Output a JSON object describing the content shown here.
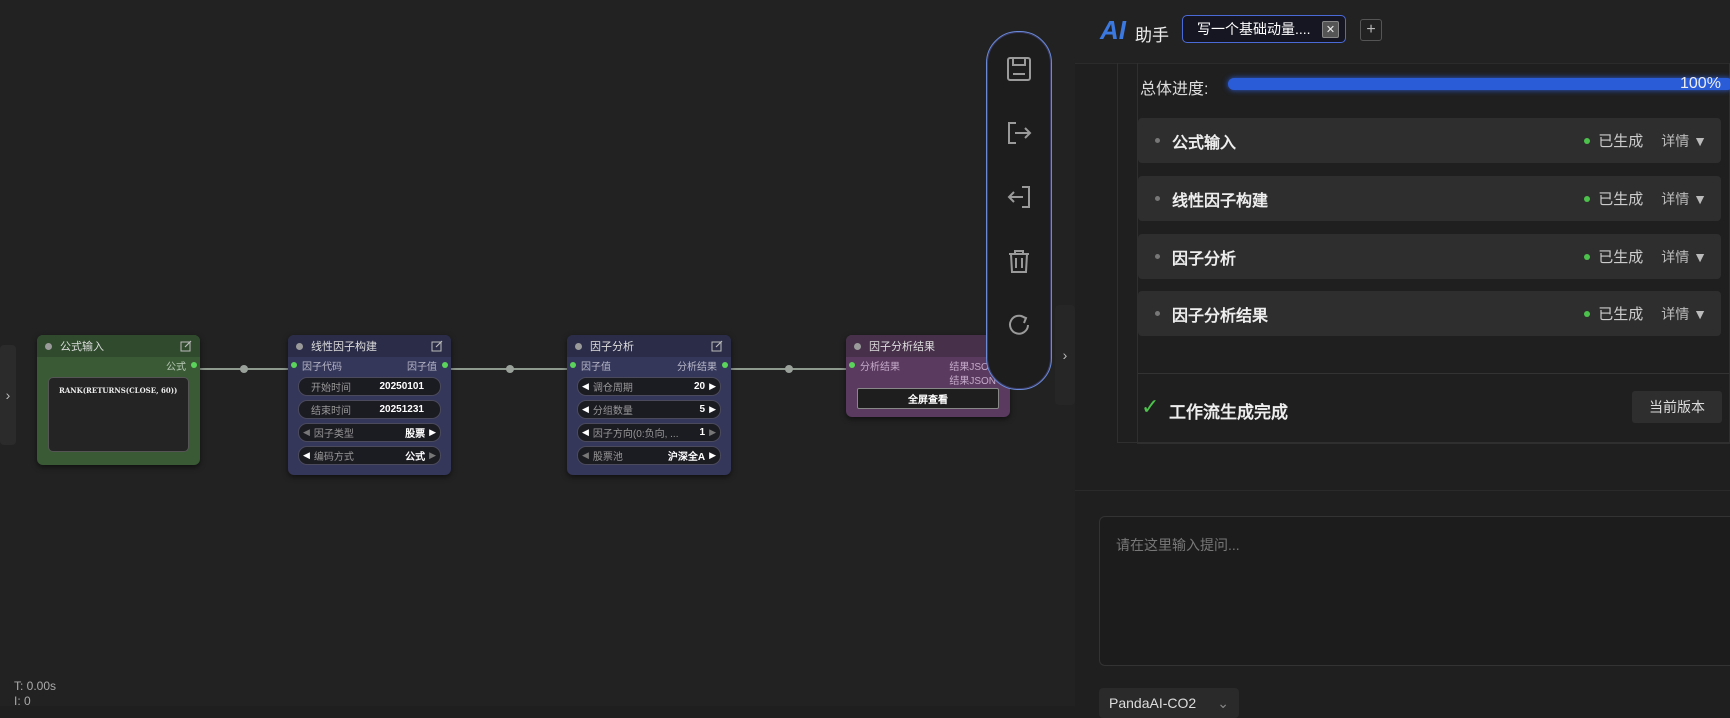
{
  "canvas": {
    "nodes": {
      "formula": {
        "title": "公式输入",
        "output_label": "公式",
        "formula_text": "RANK(RETURNS(CLOSE, 60))"
      },
      "linear": {
        "title": "线性因子构建",
        "input_label": "因子代码",
        "output_label": "因子值",
        "widgets": [
          {
            "label": "开始时间",
            "value": "20250101"
          },
          {
            "label": "结束时间",
            "value": "20251231"
          },
          {
            "label": "因子类型",
            "value": "股票"
          },
          {
            "label": "编码方式",
            "value": "公式"
          }
        ]
      },
      "analysis": {
        "title": "因子分析",
        "input_label": "因子值",
        "output_label": "分析结果",
        "widgets": [
          {
            "label": "调仓周期",
            "value": "20"
          },
          {
            "label": "分组数量",
            "value": "5"
          },
          {
            "label": "因子方向(0:负向, ...",
            "value": "1"
          },
          {
            "label": "股票池",
            "value": "沪深全A"
          }
        ]
      },
      "result": {
        "title": "因子分析结果",
        "input_label": "分析结果",
        "output_labels": [
          "结果JSON",
          "结果JSON"
        ],
        "button_label": "全屏查看"
      }
    },
    "stats": {
      "time": "T: 0.00s",
      "line2": "I: 0"
    }
  },
  "toolbar": {
    "buttons": [
      {
        "icon": "save-icon"
      },
      {
        "icon": "export-icon"
      },
      {
        "icon": "import-icon"
      },
      {
        "icon": "trash-icon"
      },
      {
        "icon": "refresh-icon"
      }
    ]
  },
  "panel": {
    "logo": "AI",
    "title": "助手",
    "tab_label": "写一个基础动量....",
    "add_tab": "+",
    "progress": {
      "label": "总体进度:",
      "value_text": "100%",
      "fraction": 1.0
    },
    "steps": [
      {
        "name": "公式输入",
        "status": "已生成",
        "detail": "详情 ▼"
      },
      {
        "name": "线性因子构建",
        "status": "已生成",
        "detail": "详情 ▼"
      },
      {
        "name": "因子分析",
        "status": "已生成",
        "detail": "详情 ▼"
      },
      {
        "name": "因子分析结果",
        "status": "已生成",
        "detail": "详情 ▼"
      }
    ],
    "complete": {
      "check": "✓",
      "text": "工作流生成完成",
      "version_button": "当前版本"
    },
    "prompt_placeholder": "请在这里输入提问...",
    "model_chip": "PandaAI-CO2",
    "model_chip_arrow": "⌄"
  },
  "colors": {
    "accent_blue": "#2b5cd8",
    "formula_node": "#3a5a36",
    "func_node": "#34365a",
    "result_node": "#5a3a5e",
    "toolbar_border": "#6a8ad8",
    "status_green": "#4cc24c"
  }
}
